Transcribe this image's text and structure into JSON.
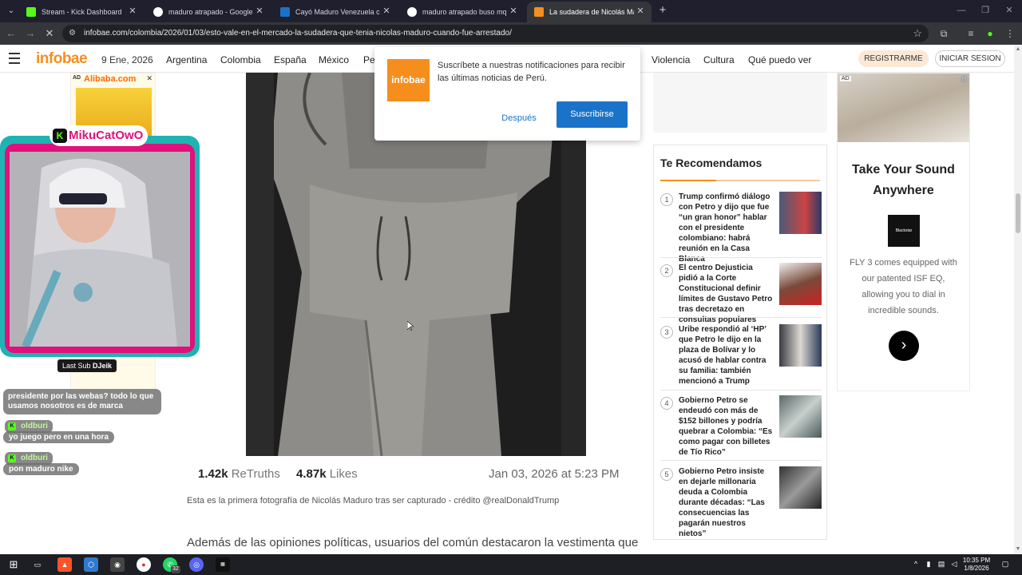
{
  "browser": {
    "tabs": [
      {
        "title": "Stream - Kick Dashboard",
        "icon": "kick-icon",
        "color": "#53fc18",
        "active": false
      },
      {
        "title": "maduro atrapado - Google Sea",
        "icon": "google-icon",
        "color": "#ffffff",
        "active": false
      },
      {
        "title": "Cayó Maduro Venezuela celebr",
        "icon": "news-icon",
        "color": "#1a73c8",
        "active": false
      },
      {
        "title": "maduro atrapado buso mque n",
        "icon": "google-icon",
        "color": "#ffffff",
        "active": false
      },
      {
        "title": "La sudadera de Nicolás Madur",
        "icon": "infobae-icon",
        "color": "#f68e1e",
        "active": true
      }
    ],
    "url": "infobae.com/colombia/2026/01/03/esto-vale-en-el-mercado-la-sudadera-que-tenia-nicolas-maduro-cuando-fue-arrestado/"
  },
  "header": {
    "logo": "infobae",
    "date": "9 Ene, 2026",
    "nav": [
      "Argentina",
      "Colombia",
      "España",
      "México",
      "Pe",
      "Violencia",
      "Cultura",
      "Qué puedo ver"
    ],
    "register": "REGISTRARME",
    "login": "INICIAR SESION"
  },
  "notification": {
    "logo": "infobae",
    "message": "Suscríbete a nuestras notificaciones para recibir las últimas noticias de Perú.",
    "later": "Después",
    "subscribe": "Suscribirse"
  },
  "article": {
    "retruths_count": "1.42k",
    "retruths_label": "ReTruths",
    "likes_count": "4.87k",
    "likes_label": "Likes",
    "post_date": "Jan 03, 2026 at 5:23 PM",
    "caption": "Esta es la primera fotografía de Nicolás Maduro tras ser capturado - crédito @realDonaldTrump",
    "body": "Además de las opiniones políticas, usuarios del común destacaron la vestimenta que"
  },
  "recommendations": {
    "title": "Te Recomendamos",
    "items": [
      {
        "num": "1",
        "text": "Trump confirmó diálogo con Petro y dijo que fue “un gran honor” hablar con el presidente colombiano: habrá reunión en la Casa Blanca"
      },
      {
        "num": "2",
        "text": "El centro Dejusticia pidió a la Corte Constitucional definir límites de Gustavo Petro tras decretazo en consultas populares"
      },
      {
        "num": "3",
        "text": "Uribe respondió al ‘HP’ que Petro le dijo en la plaza de Bolívar y lo acusó de hablar contra su familia: también mencionó a Trump"
      },
      {
        "num": "4",
        "text": "Gobierno Petro se endeudó con más de $152 billones y podría quebrar a Colombia: “Es como pagar con billetes de Tío Rico”"
      },
      {
        "num": "5",
        "text": "Gobierno Petro insiste en dejarle millonaria deuda a Colombia durante décadas: “Las consecuencias las pagarán nuestros nietos”"
      }
    ]
  },
  "ad_right": {
    "tag": "AD",
    "headline": "Take Your Sound Anywhere",
    "brand": "Blackstar",
    "body": "FLY 3 comes equipped with our patented ISF EQ, allowing you to dial in incredible sounds."
  },
  "ad_left": {
    "tag": "AD",
    "brand": "Alibaba.com"
  },
  "stream": {
    "streamer": "MikuCatOwO",
    "last_sub_label": "Last Sub",
    "last_sub_name": "DJeik",
    "chat": [
      {
        "user": "",
        "message": "presidente por las webas? todo lo que usamos nosotros es de marca"
      },
      {
        "user": "oldburi",
        "message": "yo juego pero en una hora"
      },
      {
        "user": "oldburi",
        "message": "pon maduro nike"
      }
    ]
  },
  "taskbar": {
    "time": "10:35 PM",
    "date": "1/8/2026",
    "whatsapp_badge": "32"
  }
}
